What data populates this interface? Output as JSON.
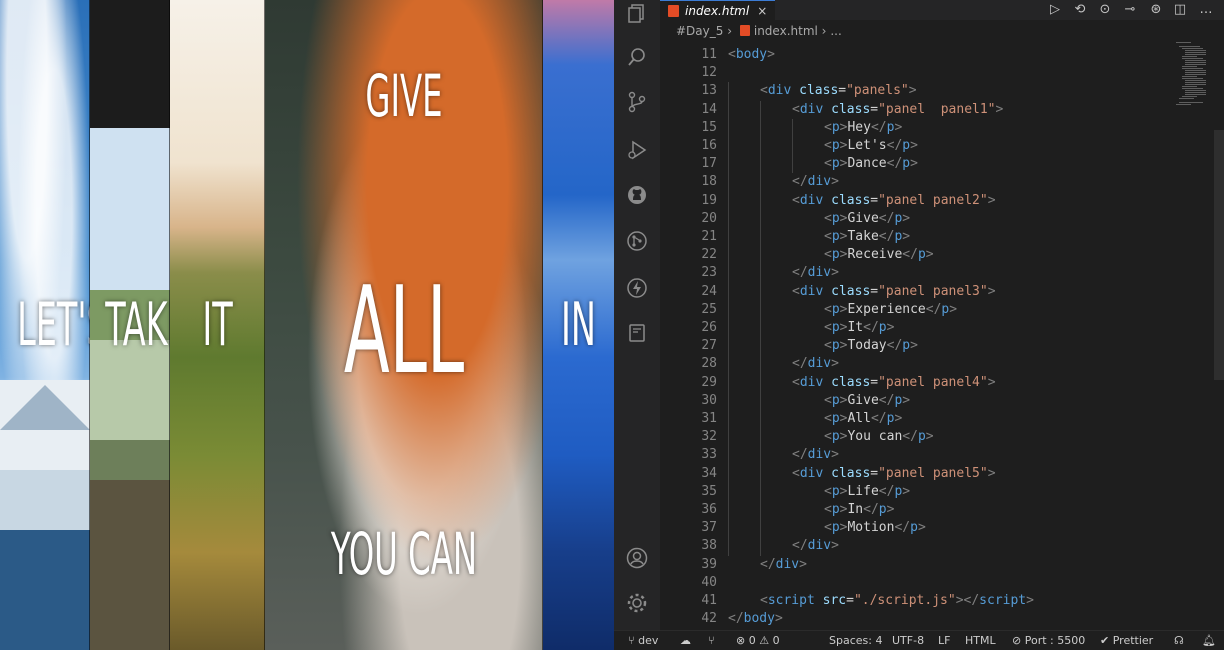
{
  "preview": {
    "panels": [
      {
        "id": "panel1",
        "words": [
          "",
          "LET'S",
          ""
        ]
      },
      {
        "id": "panel2",
        "words": [
          "",
          "TAKE",
          ""
        ]
      },
      {
        "id": "panel3",
        "words": [
          "",
          "IT",
          ""
        ]
      },
      {
        "id": "panel4",
        "words": [
          "GIVE",
          "ALL",
          "YOU CAN"
        ]
      },
      {
        "id": "panel5",
        "words": [
          "",
          "IN",
          ""
        ]
      }
    ]
  },
  "editor": {
    "tab": {
      "filename": "index.html",
      "close": "×"
    },
    "breadcrumb": {
      "folder": "#Day_5",
      "sep": "›",
      "file": "index.html",
      "more": "..."
    },
    "lines": [
      {
        "n": "11",
        "indent": 0,
        "tokens": [
          [
            "br",
            "<"
          ],
          [
            "tag",
            "body"
          ],
          [
            "br",
            ">"
          ]
        ]
      },
      {
        "n": "12",
        "indent": 0,
        "tokens": []
      },
      {
        "n": "13",
        "indent": 1,
        "tokens": [
          [
            "br",
            "<"
          ],
          [
            "tag",
            "div"
          ],
          [
            "txt",
            " "
          ],
          [
            "attr",
            "class"
          ],
          [
            "txt",
            "="
          ],
          [
            "str",
            "\"panels\""
          ],
          [
            "br",
            ">"
          ]
        ]
      },
      {
        "n": "14",
        "indent": 2,
        "tokens": [
          [
            "br",
            "<"
          ],
          [
            "tag",
            "div"
          ],
          [
            "txt",
            " "
          ],
          [
            "attr",
            "class"
          ],
          [
            "txt",
            "="
          ],
          [
            "str",
            "\"panel  panel1\""
          ],
          [
            "br",
            ">"
          ]
        ]
      },
      {
        "n": "15",
        "indent": 3,
        "tokens": [
          [
            "br",
            "<"
          ],
          [
            "tag",
            "p"
          ],
          [
            "br",
            ">"
          ],
          [
            "txt",
            "Hey"
          ],
          [
            "br",
            "</"
          ],
          [
            "tag",
            "p"
          ],
          [
            "br",
            ">"
          ]
        ]
      },
      {
        "n": "16",
        "indent": 3,
        "tokens": [
          [
            "br",
            "<"
          ],
          [
            "tag",
            "p"
          ],
          [
            "br",
            ">"
          ],
          [
            "txt",
            "Let's"
          ],
          [
            "br",
            "</"
          ],
          [
            "tag",
            "p"
          ],
          [
            "br",
            ">"
          ]
        ]
      },
      {
        "n": "17",
        "indent": 3,
        "tokens": [
          [
            "br",
            "<"
          ],
          [
            "tag",
            "p"
          ],
          [
            "br",
            ">"
          ],
          [
            "txt",
            "Dance"
          ],
          [
            "br",
            "</"
          ],
          [
            "tag",
            "p"
          ],
          [
            "br",
            ">"
          ]
        ]
      },
      {
        "n": "18",
        "indent": 2,
        "tokens": [
          [
            "br",
            "</"
          ],
          [
            "tag",
            "div"
          ],
          [
            "br",
            ">"
          ]
        ]
      },
      {
        "n": "19",
        "indent": 2,
        "tokens": [
          [
            "br",
            "<"
          ],
          [
            "tag",
            "div"
          ],
          [
            "txt",
            " "
          ],
          [
            "attr",
            "class"
          ],
          [
            "txt",
            "="
          ],
          [
            "str",
            "\"panel panel2\""
          ],
          [
            "br",
            ">"
          ]
        ]
      },
      {
        "n": "20",
        "indent": 3,
        "tokens": [
          [
            "br",
            "<"
          ],
          [
            "tag",
            "p"
          ],
          [
            "br",
            ">"
          ],
          [
            "txt",
            "Give"
          ],
          [
            "br",
            "</"
          ],
          [
            "tag",
            "p"
          ],
          [
            "br",
            ">"
          ]
        ]
      },
      {
        "n": "21",
        "indent": 3,
        "tokens": [
          [
            "br",
            "<"
          ],
          [
            "tag",
            "p"
          ],
          [
            "br",
            ">"
          ],
          [
            "txt",
            "Take"
          ],
          [
            "br",
            "</"
          ],
          [
            "tag",
            "p"
          ],
          [
            "br",
            ">"
          ]
        ]
      },
      {
        "n": "22",
        "indent": 3,
        "tokens": [
          [
            "br",
            "<"
          ],
          [
            "tag",
            "p"
          ],
          [
            "br",
            ">"
          ],
          [
            "txt",
            "Receive"
          ],
          [
            "br",
            "</"
          ],
          [
            "tag",
            "p"
          ],
          [
            "br",
            ">"
          ]
        ]
      },
      {
        "n": "23",
        "indent": 2,
        "tokens": [
          [
            "br",
            "</"
          ],
          [
            "tag",
            "div"
          ],
          [
            "br",
            ">"
          ]
        ]
      },
      {
        "n": "24",
        "indent": 2,
        "tokens": [
          [
            "br",
            "<"
          ],
          [
            "tag",
            "div"
          ],
          [
            "txt",
            " "
          ],
          [
            "attr",
            "class"
          ],
          [
            "txt",
            "="
          ],
          [
            "str",
            "\"panel panel3\""
          ],
          [
            "br",
            ">"
          ]
        ]
      },
      {
        "n": "25",
        "indent": 3,
        "tokens": [
          [
            "br",
            "<"
          ],
          [
            "tag",
            "p"
          ],
          [
            "br",
            ">"
          ],
          [
            "txt",
            "Experience"
          ],
          [
            "br",
            "</"
          ],
          [
            "tag",
            "p"
          ],
          [
            "br",
            ">"
          ]
        ]
      },
      {
        "n": "26",
        "indent": 3,
        "tokens": [
          [
            "br",
            "<"
          ],
          [
            "tag",
            "p"
          ],
          [
            "br",
            ">"
          ],
          [
            "txt",
            "It"
          ],
          [
            "br",
            "</"
          ],
          [
            "tag",
            "p"
          ],
          [
            "br",
            ">"
          ]
        ]
      },
      {
        "n": "27",
        "indent": 3,
        "tokens": [
          [
            "br",
            "<"
          ],
          [
            "tag",
            "p"
          ],
          [
            "br",
            ">"
          ],
          [
            "txt",
            "Today"
          ],
          [
            "br",
            "</"
          ],
          [
            "tag",
            "p"
          ],
          [
            "br",
            ">"
          ]
        ]
      },
      {
        "n": "28",
        "indent": 2,
        "tokens": [
          [
            "br",
            "</"
          ],
          [
            "tag",
            "div"
          ],
          [
            "br",
            ">"
          ]
        ]
      },
      {
        "n": "29",
        "indent": 2,
        "tokens": [
          [
            "br",
            "<"
          ],
          [
            "tag",
            "div"
          ],
          [
            "txt",
            " "
          ],
          [
            "attr",
            "class"
          ],
          [
            "txt",
            "="
          ],
          [
            "str",
            "\"panel panel4\""
          ],
          [
            "br",
            ">"
          ]
        ]
      },
      {
        "n": "30",
        "indent": 3,
        "tokens": [
          [
            "br",
            "<"
          ],
          [
            "tag",
            "p"
          ],
          [
            "br",
            ">"
          ],
          [
            "txt",
            "Give"
          ],
          [
            "br",
            "</"
          ],
          [
            "tag",
            "p"
          ],
          [
            "br",
            ">"
          ]
        ]
      },
      {
        "n": "31",
        "indent": 3,
        "tokens": [
          [
            "br",
            "<"
          ],
          [
            "tag",
            "p"
          ],
          [
            "br",
            ">"
          ],
          [
            "txt",
            "All"
          ],
          [
            "br",
            "</"
          ],
          [
            "tag",
            "p"
          ],
          [
            "br",
            ">"
          ]
        ]
      },
      {
        "n": "32",
        "indent": 3,
        "tokens": [
          [
            "br",
            "<"
          ],
          [
            "tag",
            "p"
          ],
          [
            "br",
            ">"
          ],
          [
            "txt",
            "You can"
          ],
          [
            "br",
            "</"
          ],
          [
            "tag",
            "p"
          ],
          [
            "br",
            ">"
          ]
        ]
      },
      {
        "n": "33",
        "indent": 2,
        "tokens": [
          [
            "br",
            "</"
          ],
          [
            "tag",
            "div"
          ],
          [
            "br",
            ">"
          ]
        ]
      },
      {
        "n": "34",
        "indent": 2,
        "tokens": [
          [
            "br",
            "<"
          ],
          [
            "tag",
            "div"
          ],
          [
            "txt",
            " "
          ],
          [
            "attr",
            "class"
          ],
          [
            "txt",
            "="
          ],
          [
            "str",
            "\"panel panel5\""
          ],
          [
            "br",
            ">"
          ]
        ]
      },
      {
        "n": "35",
        "indent": 3,
        "tokens": [
          [
            "br",
            "<"
          ],
          [
            "tag",
            "p"
          ],
          [
            "br",
            ">"
          ],
          [
            "txt",
            "Life"
          ],
          [
            "br",
            "</"
          ],
          [
            "tag",
            "p"
          ],
          [
            "br",
            ">"
          ]
        ]
      },
      {
        "n": "36",
        "indent": 3,
        "tokens": [
          [
            "br",
            "<"
          ],
          [
            "tag",
            "p"
          ],
          [
            "br",
            ">"
          ],
          [
            "txt",
            "In"
          ],
          [
            "br",
            "</"
          ],
          [
            "tag",
            "p"
          ],
          [
            "br",
            ">"
          ]
        ]
      },
      {
        "n": "37",
        "indent": 3,
        "tokens": [
          [
            "br",
            "<"
          ],
          [
            "tag",
            "p"
          ],
          [
            "br",
            ">"
          ],
          [
            "txt",
            "Motion"
          ],
          [
            "br",
            "</"
          ],
          [
            "tag",
            "p"
          ],
          [
            "br",
            ">"
          ]
        ]
      },
      {
        "n": "38",
        "indent": 2,
        "tokens": [
          [
            "br",
            "</"
          ],
          [
            "tag",
            "div"
          ],
          [
            "br",
            ">"
          ]
        ]
      },
      {
        "n": "39",
        "indent": 1,
        "tokens": [
          [
            "br",
            "</"
          ],
          [
            "tag",
            "div"
          ],
          [
            "br",
            ">"
          ]
        ]
      },
      {
        "n": "40",
        "indent": 0,
        "tokens": []
      },
      {
        "n": "41",
        "indent": 1,
        "tokens": [
          [
            "br",
            "<"
          ],
          [
            "tag",
            "script"
          ],
          [
            "txt",
            " "
          ],
          [
            "attr",
            "src"
          ],
          [
            "txt",
            "="
          ],
          [
            "str",
            "\"./script.js\""
          ],
          [
            "br",
            "></"
          ],
          [
            "tag",
            "script"
          ],
          [
            "br",
            ">"
          ]
        ]
      },
      {
        "n": "42",
        "indent": 0,
        "tokens": [
          [
            "br",
            "</"
          ],
          [
            "tag",
            "body"
          ],
          [
            "br",
            ">"
          ]
        ]
      }
    ]
  },
  "statusbar": {
    "branch": "dev",
    "errors": "0",
    "warnings": "0",
    "spaces": "Spaces: 4",
    "encoding": "UTF-8",
    "eol": "LF",
    "language": "HTML",
    "port": "Port : 5500",
    "prettier": "Prettier"
  },
  "icons": {
    "explorer": "explorer-icon",
    "search": "search-icon",
    "scm": "source-control-icon",
    "run": "run-debug-icon",
    "github": "github-icon",
    "gitlens": "gitlens-icon",
    "thunder": "thunder-client-icon",
    "notebook": "notebook-icon",
    "account": "account-icon",
    "settings": "settings-gear-icon"
  },
  "colors": {
    "tag": "#569cd6",
    "attr": "#9cdcfe",
    "string": "#ce9178",
    "bracket": "#808080",
    "html_badge": "#e34c26"
  }
}
